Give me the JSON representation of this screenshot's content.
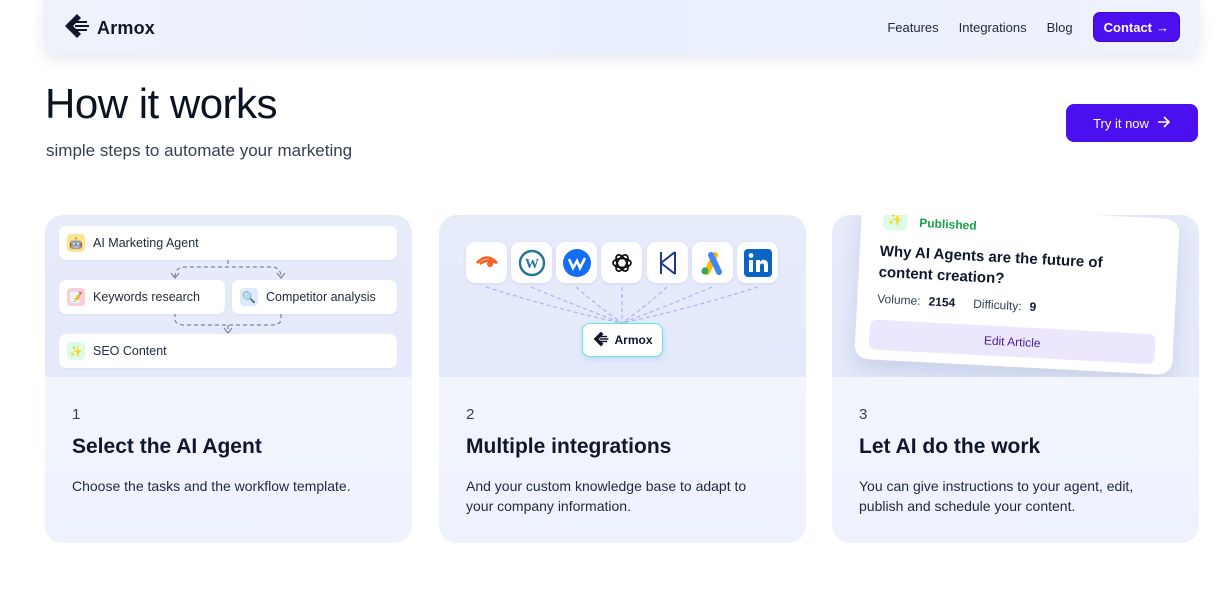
{
  "navbar": {
    "brand": "Armox",
    "links": [
      "Features",
      "Integrations",
      "Blog"
    ],
    "contact_label": "Contact",
    "accent_color": "#4c0ff0"
  },
  "hero": {
    "title": "How it works",
    "subtitle": "simple steps to automate your marketing",
    "cta_label": "Try it now"
  },
  "cards": [
    {
      "number": "1",
      "title": "Select the AI Agent",
      "description": "Choose the tasks and the workflow template.",
      "workflow": {
        "agent": "AI Marketing Agent",
        "task_left": "Keywords research",
        "task_right": "Competitor analysis",
        "output": "SEO Content"
      }
    },
    {
      "number": "2",
      "title": "Multiple integrations",
      "description": "And your custom knowledge base to adapt to your company information.",
      "integrations": [
        "semrush-icon",
        "wordpress-icon",
        "webflow-icon",
        "openai-icon",
        "klaviyo-icon",
        "google-ads-icon",
        "linkedin-icon"
      ],
      "hub_label": "Armox"
    },
    {
      "number": "3",
      "title": "Let AI do the work",
      "description": "You can give instructions to your agent, edit, publish and schedule your content.",
      "article": {
        "status": "Published",
        "title": "Why AI Agents are the future of content creation?",
        "volume_label": "Volume:",
        "volume_value": "2154",
        "difficulty_label": "Difficulty:",
        "difficulty_value": "9",
        "edit_label": "Edit Article"
      }
    }
  ]
}
